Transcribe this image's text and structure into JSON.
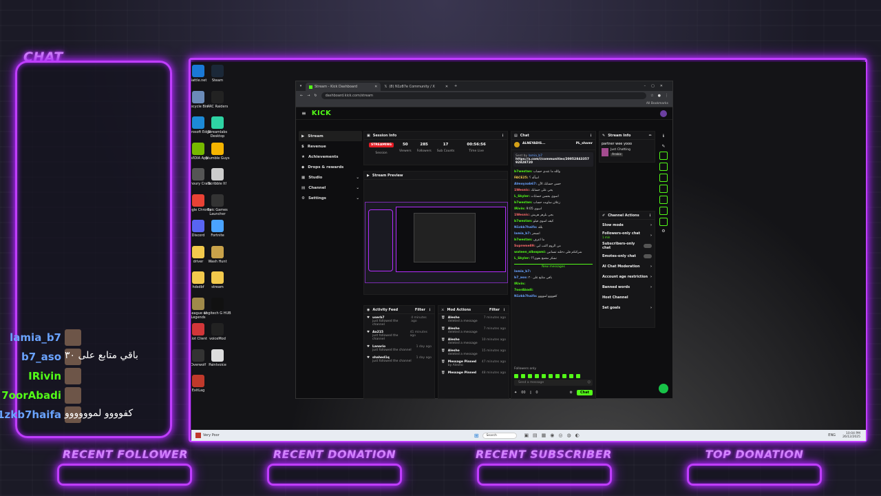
{
  "overlay": {
    "chat_title": "CHAT",
    "chat_messages": [
      {
        "username": "lamia_b7",
        "message": "",
        "color": "#6aa3ff"
      },
      {
        "username": "b7_aso",
        "message": "باقي متابع على ٣٠",
        "color": "#6aa3ff"
      },
      {
        "username": "IRivin",
        "message": "",
        "color": "#53fc18"
      },
      {
        "username": "7oorAbadi",
        "message": "",
        "color": "#53fc18"
      },
      {
        "username": "1zkb7haifa",
        "message": "كفوووو لموووووو",
        "color": "#6aa3ff"
      }
    ],
    "bottom_labels": [
      "RECENT FOLLOWER",
      "RECENT DONATION",
      "RECENT SUBSCRIBER",
      "TOP DONATION"
    ],
    "accent": "#c03dff"
  },
  "desktop_icons": [
    {
      "label": "Battle.net",
      "color": "#1a79d6"
    },
    {
      "label": "Steam",
      "color": "#1b2838"
    },
    {
      "label": "Recycle Bin",
      "color": "#6b8bb8"
    },
    {
      "label": "ARC Raiders",
      "color": "#222"
    },
    {
      "label": "Microsoft Edge",
      "color": "#1c8ad6"
    },
    {
      "label": "Streamlabs Desktop",
      "color": "#2ed3a3"
    },
    {
      "label": "NVIDIA App",
      "color": "#76b900"
    },
    {
      "label": "Stumble Guys",
      "color": "#f4b400"
    },
    {
      "label": "Armoury Crate",
      "color": "#555"
    },
    {
      "label": "Scribble It!",
      "color": "#ccc"
    },
    {
      "label": "Google Chrome",
      "color": "#e94235"
    },
    {
      "label": "Epic Games Launcher",
      "color": "#333"
    },
    {
      "label": "Discord",
      "color": "#5865f2"
    },
    {
      "label": "Fortnite",
      "color": "#4aa3ff"
    },
    {
      "label": "driver",
      "color": "#f2c94c"
    },
    {
      "label": "Wash Hunt",
      "color": "#c9a24a"
    },
    {
      "label": "hdsdbf",
      "color": "#f2c94c"
    },
    {
      "label": "stream",
      "color": "#f2c94c"
    },
    {
      "label": "League of Legends",
      "color": "#a08a4a"
    },
    {
      "label": "Logitech G HUB",
      "color": "#111"
    },
    {
      "label": "Riot Client",
      "color": "#d13639"
    },
    {
      "label": "voiceMod",
      "color": "#222"
    },
    {
      "label": "Overwolf",
      "color": "#333"
    },
    {
      "label": "Paintvoice",
      "color": "#ddd"
    },
    {
      "label": "ExitLag",
      "color": "#c0392b"
    }
  ],
  "browser": {
    "tabs": [
      "Stream - Kick Dashboard",
      "(8) N1z87e Community / X"
    ],
    "url": "dashboard.kick.com/stream",
    "bookmarks": "All Bookmarks"
  },
  "kick": {
    "logo": "KICK",
    "nav": [
      "Stream",
      "Revenue",
      "Achievements",
      "Drops & rewards",
      "Studio",
      "Channel",
      "Settings"
    ],
    "session": {
      "title": "Session Info",
      "badge": "STREAMING",
      "session_label": "Session",
      "viewers": "50",
      "viewers_label": "Viewers",
      "followers": "285",
      "followers_label": "Followers",
      "subs": "17",
      "subs_label": "Sub Counts",
      "time": "00:56:56",
      "time_label": "Time Live"
    },
    "preview_title": "Stream Preview",
    "activity": {
      "title": "Activity Feed",
      "filter": "Filter",
      "items": [
        {
          "who": "userb7",
          "sub": "just followed the channel",
          "time": "4 minutes ago"
        },
        {
          "who": "Aa215",
          "sub": "just followed the channel",
          "time": "41 minutes ago"
        },
        {
          "who": "Lanario",
          "sub": "just followed the channel",
          "time": "1 day ago"
        },
        {
          "who": "shahed1q",
          "sub": "just followed the channel",
          "time": "1 day ago"
        }
      ]
    },
    "mod": {
      "title": "Mod Actions",
      "filter": "Filter",
      "items": [
        {
          "who": "Alesho",
          "sub": "deleted a message",
          "time": "7 minutes ago"
        },
        {
          "who": "Alesho",
          "sub": "deleted a message",
          "time": "7 minutes ago"
        },
        {
          "who": "Alesho",
          "sub": "deleted a message",
          "time": "10 minutes ago"
        },
        {
          "who": "Alesho",
          "sub": "deleted a message",
          "time": "15 minutes ago"
        },
        {
          "who": "Message Pinned",
          "sub": "by Alesho",
          "time": "47 minutes ago"
        },
        {
          "who": "Message Pinned",
          "sub": "",
          "time": "48 minutes ago"
        }
      ]
    },
    "chat": {
      "title": "Chat",
      "top_user": "ALNEYADIS...",
      "top_user2": "PL_shamr",
      "pinned_by": "Sent by",
      "pinned_user": "lamia_b7",
      "pinned_link": "https://x.com/i/communities/2005284335792828720",
      "lines": [
        {
          "user": "b7westan:",
          "msg": "والله ما عندي حساب",
          "color": "#53fc18"
        },
        {
          "user": "FACE25:",
          "msg": "اسأله ؟",
          "color": "#f2c94c"
        },
        {
          "user": "Almoyaab67:",
          "msg": "حسن حسابك الآن",
          "color": "#6aa3ff"
        },
        {
          "user": "1Wesnic:",
          "msg": "يحي على حسابك",
          "color": "#ff6b6b"
        },
        {
          "user": "L_Skyler:",
          "msg": "اسوي بحسن حسابات",
          "color": "#53fc18"
        },
        {
          "user": "b7westan:",
          "msg": "زعلان ساويت حساب",
          "color": "#53fc18"
        },
        {
          "user": "IRivin:",
          "msg": "9:05 اسوي",
          "color": "#53fc18"
        },
        {
          "user": "1Wesnic:",
          "msg": "بجي بلزهر هريش",
          "color": "#ff6b6b"
        },
        {
          "user": "b7westan:",
          "msg": "كيف اسوي فيلو",
          "color": "#53fc18"
        },
        {
          "user": "N1zkb7haifa:",
          "msg": "بلله",
          "color": "#6aa3ff"
        },
        {
          "user": "lamia_b7:",
          "msg": "انسحر",
          "color": "#6aa3ff"
        },
        {
          "user": "b7westan:",
          "msg": "ما اعرف",
          "color": "#53fc18"
        },
        {
          "user": "Supreme89:",
          "msg": "من الروم اكتب ابي",
          "color": "#ff6b6b"
        },
        {
          "user": "wateen_alboqami:",
          "msg": "شركتكم فلي دخلته تنساتين",
          "color": "#53fc18"
        },
        {
          "user": "L_Skyler:",
          "msg": "تشكر مجمع بقوي؟؟",
          "color": "#53fc18"
        }
      ],
      "new_messages": "New messages",
      "new_lines": [
        {
          "user": "lamia_b7:",
          "msg": "",
          "color": "#6aa3ff"
        },
        {
          "user": "b7_aso:",
          "msg": "باقي متابع على ٣٠",
          "color": "#6aa3ff"
        },
        {
          "user": "IRivin:",
          "msg": "",
          "color": "#53fc18"
        },
        {
          "user": "7oorAbadi:",
          "msg": "",
          "color": "#53fc18"
        },
        {
          "user": "N1zkb7haifa:",
          "msg": "كفوووو لموووو",
          "color": "#6aa3ff"
        }
      ],
      "followers_only": "Followers only",
      "placeholder": "Send a message",
      "counter1": "00",
      "counter2": "0",
      "chat_button": "Chat"
    },
    "stream_info": {
      "title": "Stream Info",
      "stream_title": "partner wee yooo",
      "category": "Just Chatting",
      "language": "Arabic"
    },
    "channel_actions": {
      "title": "Channel Actions",
      "items": [
        "Slow mode",
        "Followers-only chat",
        "Subscribers-only chat",
        "Emotes-only chat",
        "AI Chat Moderation",
        "Account age restriction",
        "Banned words",
        "Host Channel",
        "Set goals"
      ],
      "followers_sub": "1 min"
    }
  },
  "taskbar": {
    "search": "Search",
    "weather": "Very Poor",
    "time": "10:04 PM",
    "date": "26/12/2025",
    "lang": "ENG"
  }
}
